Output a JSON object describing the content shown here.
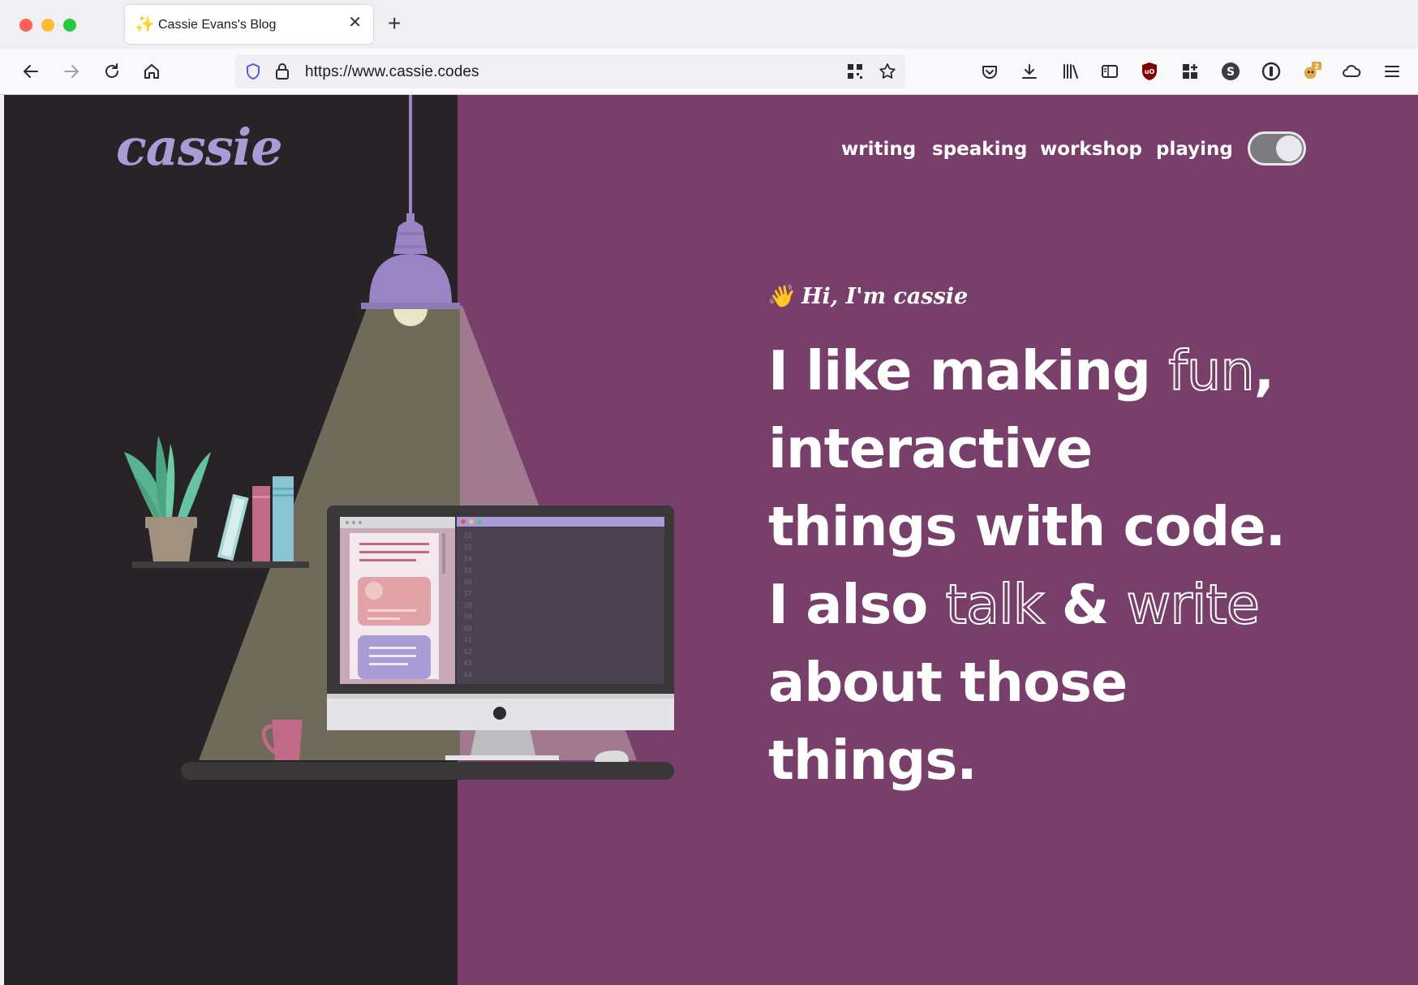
{
  "browser": {
    "tab": {
      "favicon": "sparkles-icon",
      "title": "Cassie Evans's Blog"
    },
    "url": "https://www.cassie.codes",
    "extension_badge": "2"
  },
  "site": {
    "logo": "cassie",
    "nav": [
      "writing",
      "speaking",
      "workshop",
      "playing"
    ],
    "greeting": "Hi, I'm cassie",
    "headline": {
      "l1_a": "I like making ",
      "l1_fun": "fun",
      "l1_b": ",",
      "l2": "interactive",
      "l3": "things with code.",
      "l4_a": "I also ",
      "l4_talk": "talk",
      "l4_amp": " & ",
      "l4_write": "write",
      "l5": "about those",
      "l6": "things."
    },
    "code_line_numbers": [
      "32",
      "33",
      "34",
      "35",
      "36",
      "37",
      "38",
      "39",
      "40",
      "41",
      "42",
      "43",
      "44"
    ]
  },
  "colors": {
    "page_bg": "#773f69",
    "dark_panel": "#272326",
    "logo": "#a99cd6",
    "lamp": "#9b84c4"
  }
}
